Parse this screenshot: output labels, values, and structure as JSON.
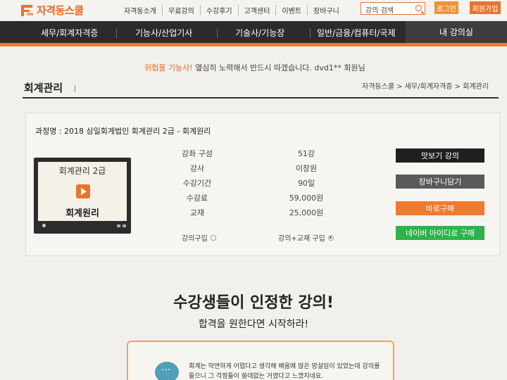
{
  "brand": {
    "name": "자격동스쿨",
    "accent": "#e8742d"
  },
  "top_links": [
    "자격동소개",
    "무료강의",
    "수강후기",
    "고객센터",
    "이벤트",
    "장바구니"
  ],
  "search": {
    "value": "강의 검색"
  },
  "auth": {
    "login": "로그인",
    "join": "회원가입"
  },
  "nav": {
    "items": [
      "세무/회계자격증",
      "기능사/산업기사",
      "기술사/기능장",
      "일반/금융/컴퓨터/국제"
    ],
    "mine": "내 강의실"
  },
  "welcome": {
    "highlight": "위험물 기능사!",
    "message": " 열심히 노력해서 반드시 따겠습니다. dvd1** 회원님"
  },
  "page": {
    "title": "회계관리",
    "breadcrumb": "자격동스쿨 > 세무/회계자격증 > 회계관리"
  },
  "course": {
    "name": "과정명 : 2018 삼일회계법인 회계관리 2급 - 회계원리",
    "thumb_top": "회계관리 2급",
    "thumb_bottom": "회계원리",
    "info": [
      {
        "label": "강좌 구성",
        "value": "51강"
      },
      {
        "label": "강사",
        "value": "이창원"
      },
      {
        "label": "수강기간",
        "value": "90일"
      },
      {
        "label": "수강료",
        "value": "59,000원"
      },
      {
        "label": "교재",
        "value": "25,000원"
      }
    ],
    "options": [
      {
        "label": "강의구입",
        "selected": false
      },
      {
        "label": "강의+교재 구입",
        "selected": true
      }
    ],
    "actions": [
      {
        "label": "맛보기 강의",
        "color": "#1f1f1f"
      },
      {
        "label": "장바구니담기",
        "color": "#5a5a5a"
      },
      {
        "label": "바로구매",
        "color": "#ee7a2e"
      },
      {
        "label": "네이버 아이디로 구매",
        "color": "#2fb24a"
      }
    ]
  },
  "promo": {
    "title": "수강생들이 인정한 강의!",
    "subtitle": "합격을 원한다면 시작하라!",
    "testimonial": "회계는 막연하게 어렵다고 생각해 배움에 많은 망설임이 있었는데 강의를 들으니 그 걱정들이 쓸데없는 거였다고 느꼈지네요."
  }
}
